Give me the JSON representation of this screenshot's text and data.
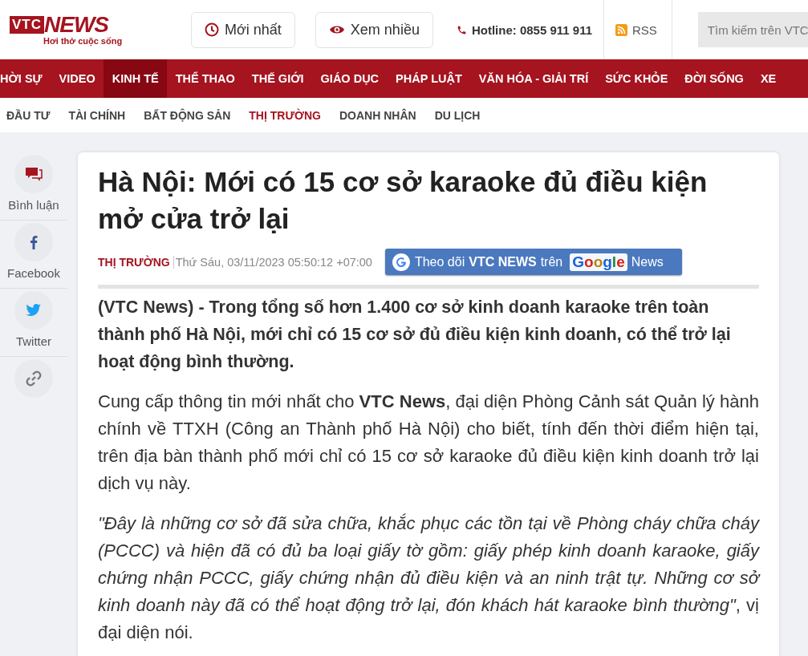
{
  "logo": {
    "mark": "VTC",
    "name": "NEWS",
    "tagline": "Hơi thở cuộc sống"
  },
  "header_buttons": [
    {
      "kind": "clock",
      "label": "Mới nhất"
    },
    {
      "kind": "eye",
      "label": "Xem nhiều"
    }
  ],
  "hotline": "Hotline: 0855 911 911",
  "rss": "RSS",
  "search": {
    "placeholder": "Tìm kiếm trên VTC"
  },
  "nav": [
    {
      "label": "HỜI SỰ",
      "selected": false
    },
    {
      "label": "VIDEO",
      "selected": false
    },
    {
      "label": "KINH TẾ",
      "selected": true
    },
    {
      "label": "THỂ THAO",
      "selected": false
    },
    {
      "label": "THẾ GIỚI",
      "selected": false
    },
    {
      "label": "GIÁO DỤC",
      "selected": false
    },
    {
      "label": "PHÁP LUẬT",
      "selected": false
    },
    {
      "label": "VĂN HÓA - GIẢI TRÍ",
      "selected": false
    },
    {
      "label": "SỨC KHỎE",
      "selected": false
    },
    {
      "label": "ĐỜI SỐNG",
      "selected": false
    },
    {
      "label": "XE",
      "selected": false
    }
  ],
  "subnav": [
    {
      "label": "ĐẦU TƯ",
      "selected": false
    },
    {
      "label": "TÀI CHÍNH",
      "selected": false
    },
    {
      "label": "BẤT ĐỘNG SẢN",
      "selected": false
    },
    {
      "label": "THỊ TRƯỜNG",
      "selected": true
    },
    {
      "label": "DOANH NHÂN",
      "selected": false
    },
    {
      "label": "DU LỊCH",
      "selected": false
    }
  ],
  "share": [
    {
      "kind": "comment",
      "label": "Bình luận"
    },
    {
      "kind": "facebook",
      "label": "Facebook"
    },
    {
      "kind": "twitter",
      "label": "Twitter"
    },
    {
      "kind": "link"
    }
  ],
  "article": {
    "title": "Hà Nội: Mới có 15 cơ sở karaoke đủ điều kiện mở cửa trở lại",
    "category": "THỊ TRƯỜNG",
    "date": "Thứ Sáu, 03/11/2023 05:50:12 +07:00",
    "follow_badge": {
      "prefix": "Theo dõi",
      "brand": "VTC NEWS",
      "middle": "trên",
      "google": "Google",
      "suffix": "News"
    },
    "lead": "(VTC News) - Trong tổng số hơn 1.400 cơ sở kinh doanh karaoke trên toàn thành phố Hà Nội, mới chỉ có 15 cơ sở đủ điều kiện kinh doanh, có thể trở lại hoạt động bình thường.",
    "paragraphs": [
      "Cung cấp thông tin mới nhất cho **VTC News**, đại diện Phòng Cảnh sát Quản lý hành chính về TTXH (Công an Thành phố Hà Nội) cho biết, tính đến thời điểm hiện tại, trên địa bàn thành phố mới chỉ có 15 cơ sở karaoke đủ điều kiện kinh doanh trở lại dịch vụ này.",
      "*\"Đây là những cơ sở đã sửa chữa, khắc phục các tồn tại về Phòng cháy chữa cháy (PCCC) và hiện đã có đủ ba loại giấy tờ gồm: giấy phép kinh doanh karaoke, giấy chứng nhận PCCC, giấy chứng nhận đủ điều kiện và an ninh trật tự. Những cơ sở kinh doanh này đã có thể hoạt động trở lại, đón khách hát karaoke bình thường\"*, vị đại diện nói."
    ]
  }
}
